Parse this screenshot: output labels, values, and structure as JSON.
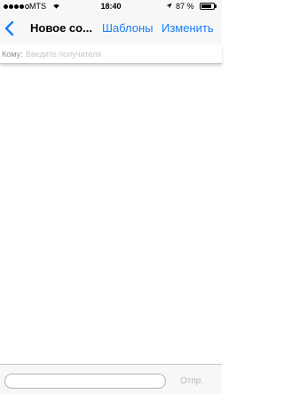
{
  "status_bar": {
    "carrier": "MTS",
    "time": "18:40",
    "battery": "87 %",
    "battery_level": 0.87,
    "icons": [
      "signal-dots",
      "wifi-icon",
      "location-arrow-icon",
      "battery-icon"
    ]
  },
  "nav": {
    "back_icon": "chevron-left-icon",
    "title": "Новое со...",
    "templates": "Шаблоны",
    "edit": "Изменить"
  },
  "to_field": {
    "label": "Кому:",
    "value": "",
    "placeholder": "Введите получателя"
  },
  "compose": {
    "message_value": "",
    "send_label": "Отпр."
  },
  "colors": {
    "accent": "#1a7dfa",
    "bar_background": "#f7f7f7",
    "placeholder": "#c7c7cd",
    "disabled": "#b8b8b8"
  }
}
